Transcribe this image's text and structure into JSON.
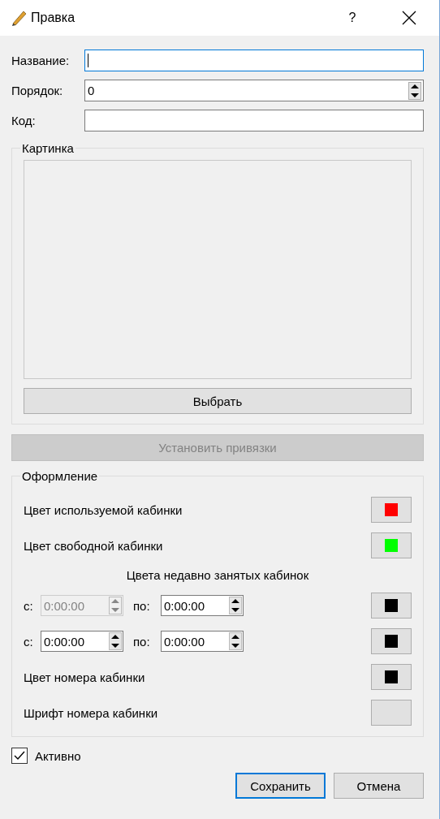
{
  "window": {
    "title": "Правка",
    "help": "?"
  },
  "fields": [
    {
      "label": "Название:",
      "kind": "text",
      "focused": true
    },
    {
      "label": "Порядок:",
      "kind": "spin",
      "value": "0",
      "focused": false
    },
    {
      "label": "Код:",
      "kind": "text",
      "focused": false
    }
  ],
  "picture_group": {
    "title": "Картинка",
    "button": "Выбрать"
  },
  "bindings_button": {
    "label": "Установить привязки",
    "disabled": true
  },
  "appearance": {
    "title": "Оформление",
    "rows": [
      {
        "kind": "color",
        "label": "Цвет используемой кабинки",
        "color": "#ff0000"
      },
      {
        "kind": "color",
        "label": "Цвет свободной кабинки",
        "color": "#00ff00"
      },
      {
        "kind": "heading",
        "label": "Цвета недавно занятых кабинок"
      },
      {
        "kind": "range",
        "from_label": "с:",
        "from": "0:00:00",
        "from_disabled": true,
        "to_label": "по:",
        "to": "0:00:00",
        "to_disabled": false,
        "color": "#000000"
      },
      {
        "kind": "range",
        "from_label": "с:",
        "from": "0:00:00",
        "from_disabled": false,
        "to_label": "по:",
        "to": "0:00:00",
        "to_disabled": false,
        "color": "#000000"
      },
      {
        "kind": "color",
        "label": "Цвет номера кабинки",
        "color": "#000000"
      },
      {
        "kind": "font",
        "label": "Шрифт номера кабинки"
      }
    ]
  },
  "active": {
    "label": "Активно",
    "checked": true
  },
  "buttons": [
    {
      "label": "Сохранить",
      "default": true
    },
    {
      "label": "Отмена",
      "default": false
    }
  ]
}
